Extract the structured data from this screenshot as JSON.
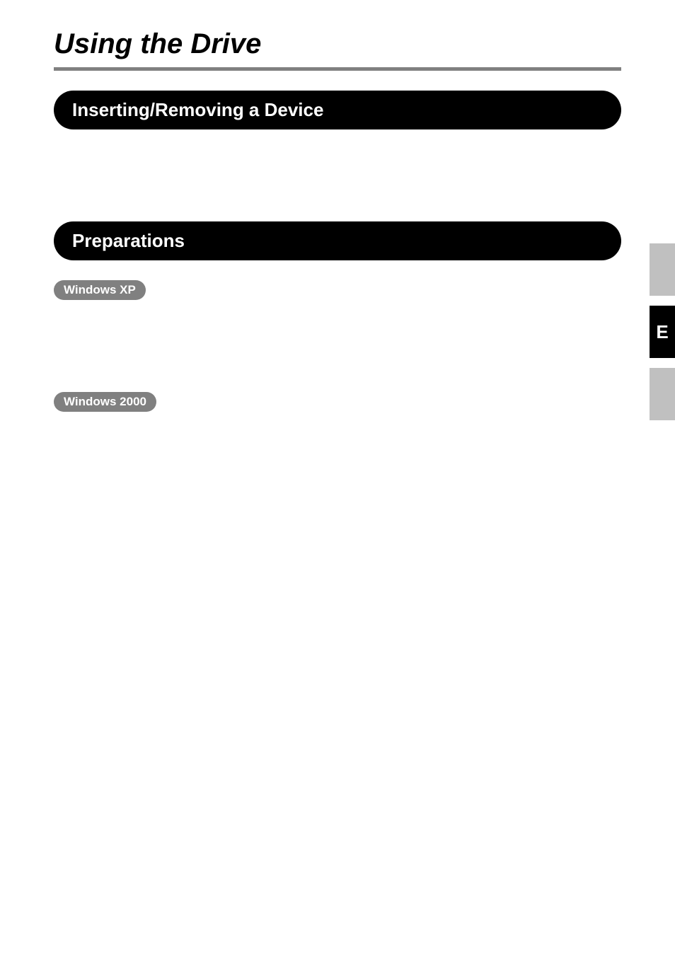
{
  "page": {
    "title": "Using the Drive"
  },
  "sections": {
    "inserting": {
      "heading": "Inserting/Removing a Device"
    },
    "preparations": {
      "heading": "Preparations",
      "os_labels": {
        "xp": "Windows XP",
        "w2000": "Windows 2000"
      }
    }
  },
  "side_tabs": {
    "active_letter": "E"
  }
}
